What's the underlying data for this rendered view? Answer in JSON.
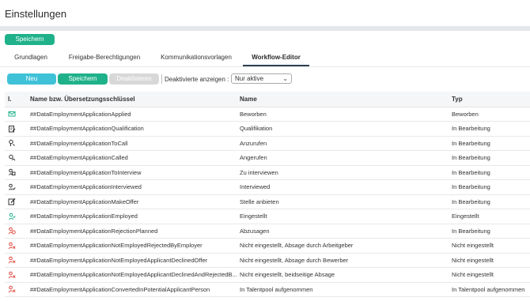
{
  "page": {
    "title": "Einstellungen"
  },
  "toolbar_top": {
    "save_label": "Speichern"
  },
  "tabs": [
    {
      "label": "Grundlagen"
    },
    {
      "label": "Freigabe-Berechtigungen"
    },
    {
      "label": "Kommunikationsvorlagen"
    },
    {
      "label": "Workflow-Editor"
    }
  ],
  "actions": {
    "new_label": "Neu",
    "save_label": "Speichern",
    "deactivate_label": "Deaktivieren",
    "show_deactivated_label": "Deaktivierte anzeigen :",
    "show_deactivated_value": "Nur aktive"
  },
  "table": {
    "headers": {
      "icon": "I.",
      "key": "Name bzw. Übersetzungsschlüssel",
      "name": "Name",
      "type": "Typ"
    },
    "rows": [
      {
        "icon": "envelope-icon",
        "key": "##DataEmploymentApplicationApplied",
        "name": "Beworben",
        "type": "Beworben"
      },
      {
        "icon": "document-edit-icon",
        "key": "##DataEmploymentApplicationQualification",
        "name": "Qualifikation",
        "type": "In Bearbeitung"
      },
      {
        "icon": "call-icon",
        "key": "##DataEmploymentApplicationToCall",
        "name": "Anzurufen",
        "type": "In Bearbeitung"
      },
      {
        "icon": "called-icon",
        "key": "##DataEmploymentApplicationCalled",
        "name": "Angerufen",
        "type": "In Bearbeitung"
      },
      {
        "icon": "interview-icon",
        "key": "##DataEmploymentApplicationToInterview",
        "name": "Zu interviewen",
        "type": "In Bearbeitung"
      },
      {
        "icon": "interviewed-icon",
        "key": "##DataEmploymentApplicationInterviewed",
        "name": "Interviewed",
        "type": "In Bearbeitung"
      },
      {
        "icon": "offer-edit-icon",
        "key": "##DataEmploymentApplicationMakeOffer",
        "name": "Stelle anbieten",
        "type": "In Bearbeitung"
      },
      {
        "icon": "user-check-icon",
        "key": "##DataEmploymentApplicationEmployed",
        "name": "Eingestellt",
        "type": "Eingestellt"
      },
      {
        "icon": "user-clock-icon",
        "key": "##DataEmploymentApplicationRejectionPlanned",
        "name": "Abzusagen",
        "type": "In Bearbeitung"
      },
      {
        "icon": "user-x-icon",
        "key": "##DataEmploymentApplicationNotEmployedRejectedByEmployer",
        "name": "Nicht eingestellt,  Absage durch Arbeitgeber",
        "type": "Nicht eingestellt"
      },
      {
        "icon": "user-x-icon",
        "key": "##DataEmploymentApplicationNotEmployedApplicantDeclinedOffer",
        "name": "Nicht eingestellt,  Absage durch Bewerber",
        "type": "Nicht eingestellt"
      },
      {
        "icon": "user-x-icon",
        "key": "##DataEmploymentApplicationNotEmployedApplicantDeclinedAndRejectedB...",
        "name": "Nicht eingestellt, beidseitige Absage",
        "type": "Nicht eingestellt"
      },
      {
        "icon": "user-x-icon",
        "key": "##DataEmploymentApplicationConvertedInPotentialApplicantPerson",
        "name": "In Talentpool aufgenommen",
        "type": "In Talentpool aufgenommen"
      }
    ]
  },
  "colors": {
    "green": "#1fb18a",
    "teal": "#3fc2d8",
    "icon_green": "#1fb18a",
    "icon_red": "#e0463c",
    "icon_dark": "#333333"
  }
}
